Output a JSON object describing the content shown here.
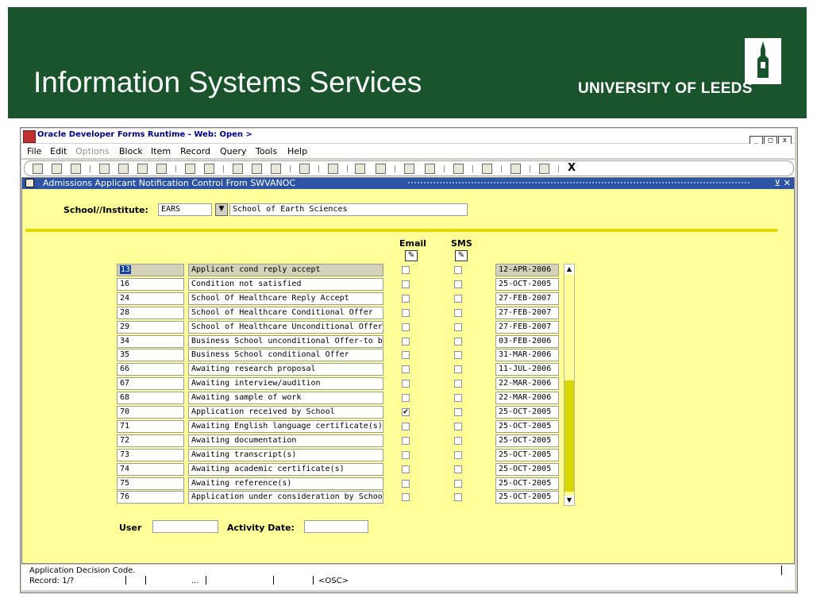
{
  "slide": {
    "title": "Information Systems Services",
    "logo_text": "UNIVERSITY OF LEEDS",
    "colors": {
      "banner": "#19542c",
      "form_bg": "#ffff99",
      "form_title_bar": "#2d54a4"
    }
  },
  "window": {
    "title": "Oracle Developer Forms Runtime - Web:  Open >",
    "controls": [
      "_",
      "□",
      "x"
    ]
  },
  "menu": [
    "File",
    "Edit",
    "Options",
    "Block",
    "Item",
    "Record",
    "Query",
    "Tools",
    "Help"
  ],
  "toolbar": {
    "exit_label": "X"
  },
  "form": {
    "title": "Admissions Applicant Notification Control From SWVANOC",
    "title_controls": "⊻ ✕",
    "school_label": "School//Institute:",
    "school_code": "EARS",
    "school_name": "School of Earth Sciences",
    "email_header": "Email",
    "sms_header": "SMS",
    "rows": [
      {
        "code": "13",
        "desc": "Applicant cond reply accept",
        "email": false,
        "sms": false,
        "date": "12-APR-2006"
      },
      {
        "code": "16",
        "desc": "Condition not satisfied",
        "email": false,
        "sms": false,
        "date": "25-OCT-2005"
      },
      {
        "code": "24",
        "desc": "School Of Healthcare Reply Accept",
        "email": false,
        "sms": false,
        "date": "27-FEB-2007"
      },
      {
        "code": "28",
        "desc": "School of Healthcare Conditional Offer",
        "email": false,
        "sms": false,
        "date": "27-FEB-2007"
      },
      {
        "code": "29",
        "desc": "School of Healthcare Unconditional Offer",
        "email": false,
        "sms": false,
        "date": "27-FEB-2007"
      },
      {
        "code": "34",
        "desc": "Business School unconditional Offer-to be ap",
        "email": false,
        "sms": false,
        "date": "03-FEB-2006"
      },
      {
        "code": "35",
        "desc": "Business School conditional Offer",
        "email": false,
        "sms": false,
        "date": "31-MAR-2006"
      },
      {
        "code": "66",
        "desc": "Awaiting research proposal",
        "email": false,
        "sms": false,
        "date": "11-JUL-2006"
      },
      {
        "code": "67",
        "desc": "Awaiting interview/audition",
        "email": false,
        "sms": false,
        "date": "22-MAR-2006"
      },
      {
        "code": "68",
        "desc": "Awaiting sample of work",
        "email": false,
        "sms": false,
        "date": "22-MAR-2006"
      },
      {
        "code": "70",
        "desc": "Application received by School",
        "email": true,
        "sms": false,
        "date": "25-OCT-2005"
      },
      {
        "code": "71",
        "desc": "Awaiting English language certificate(s)",
        "email": false,
        "sms": false,
        "date": "25-OCT-2005"
      },
      {
        "code": "72",
        "desc": "Awaiting documentation",
        "email": false,
        "sms": false,
        "date": "25-OCT-2005"
      },
      {
        "code": "73",
        "desc": "Awaiting transcript(s)",
        "email": false,
        "sms": false,
        "date": "25-OCT-2005"
      },
      {
        "code": "74",
        "desc": "Awaiting academic certificate(s)",
        "email": false,
        "sms": false,
        "date": "25-OCT-2005"
      },
      {
        "code": "75",
        "desc": "Awaiting reference(s)",
        "email": false,
        "sms": false,
        "date": "25-OCT-2005"
      },
      {
        "code": "76",
        "desc": "Application under consideration by School",
        "email": false,
        "sms": false,
        "date": "25-OCT-2005"
      }
    ],
    "user_label": "User",
    "user_value": "",
    "activity_date_label": "Activity Date:",
    "activity_date_value": ""
  },
  "status": {
    "message": "Application Decision Code.",
    "record": "Record: 1/?",
    "ellipsis": "...",
    "mode": "<OSC>"
  }
}
